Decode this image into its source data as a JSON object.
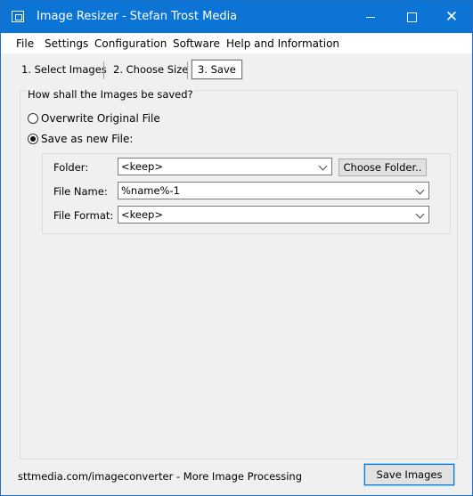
{
  "window": {
    "title": "Image Resizer - Stefan Trost Media",
    "controls": {
      "minimize_icon": "minimize-icon",
      "maximize_icon": "maximize-icon",
      "close_icon": "close-icon",
      "close_glyph": "✕"
    }
  },
  "menu": {
    "items": [
      {
        "label": "File"
      },
      {
        "label": "Settings"
      },
      {
        "label": "Configuration"
      },
      {
        "label": "Software"
      },
      {
        "label": "Help and Information"
      }
    ]
  },
  "tabs": [
    {
      "label": "1. Select Images"
    },
    {
      "label": "2. Choose Size"
    },
    {
      "label": "3. Save",
      "selected": true
    }
  ],
  "save_group": {
    "heading": "How shall the Images be saved?",
    "options": [
      {
        "label": "Overwrite Original File",
        "checked": false
      },
      {
        "label": "Save as new File:",
        "checked": true
      }
    ],
    "fields": {
      "folder": {
        "label": "Folder:",
        "value": "<keep>",
        "button": "Choose Folder.."
      },
      "file_name": {
        "label": "File Name:",
        "value": "%name%-1"
      },
      "file_format": {
        "label": "File Format:",
        "value": "<keep>"
      }
    }
  },
  "footer": {
    "link_text": "sttmedia.com/imageconverter - More Image Processing",
    "save_button": "Save Images"
  },
  "colors": {
    "titlebar": "#0b74d4",
    "window_bg": "#f0f0f0",
    "accent_border": "#0078d7"
  }
}
